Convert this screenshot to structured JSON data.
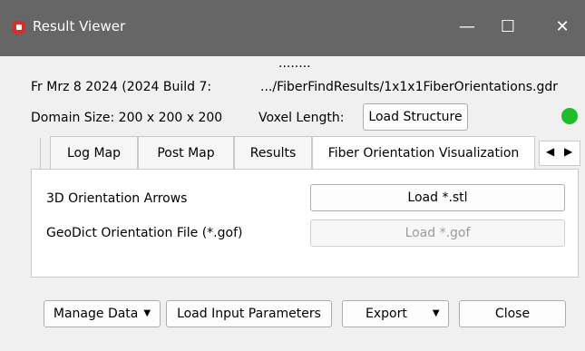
{
  "window": {
    "title": "Result Viewer",
    "controls": {
      "minimize": "—",
      "maximize": "☐",
      "close": "✕"
    }
  },
  "splitter": "........",
  "info": {
    "version": "Fr Mrz 8 2024 (2024 Build 7:",
    "file_path": ".../FiberFindResults/1x1x1FiberOrientations.gdr",
    "domain_size": "Domain Size: 200 x 200 x 200",
    "voxel_length": "Voxel Length:",
    "load_structure": "Load Structure",
    "status_color": "#1fbd2a"
  },
  "tabs": [
    {
      "label": "Log Map",
      "active": false
    },
    {
      "label": "Post Map",
      "active": false
    },
    {
      "label": "Results",
      "active": false
    },
    {
      "label": "Fiber Orientation Visualization",
      "active": true
    }
  ],
  "tab_scroll": {
    "left": "◀",
    "right": "▶"
  },
  "panel": {
    "rows": [
      {
        "label": "3D Orientation Arrows",
        "button": "Load *.stl",
        "enabled": true
      },
      {
        "label": "GeoDict Orientation File (*.gof)",
        "button": "Load *.gof",
        "enabled": false
      }
    ]
  },
  "footer": {
    "manage_data": "Manage Data",
    "load_input": "Load Input Parameters",
    "export": "Export",
    "close": "Close"
  }
}
